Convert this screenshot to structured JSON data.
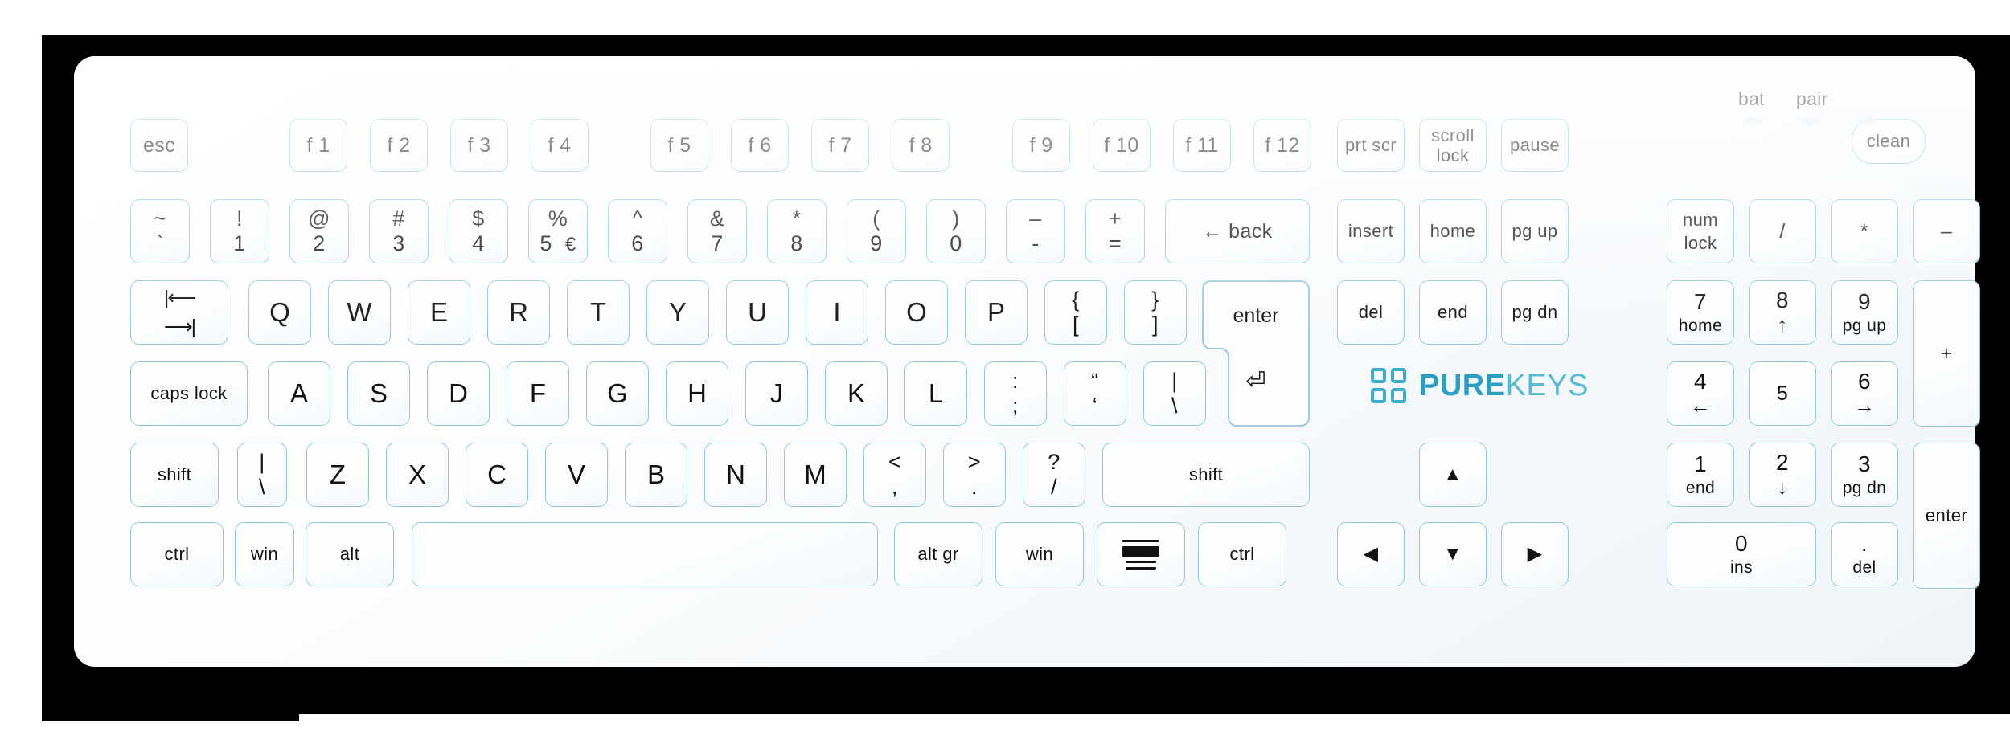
{
  "device": {
    "brand_bold": "PURE",
    "brand_light": "KEYS",
    "layout": "US / ANSI-ISO hybrid full-size hygienic keyboard"
  },
  "indicators": {
    "labels": [
      {
        "name": "bat",
        "text": "bat"
      },
      {
        "name": "pair",
        "text": "pair"
      }
    ],
    "leds": [
      "led-bat",
      "led-pair",
      "led-third"
    ]
  },
  "accent_colors": {
    "key_border": "#8fc8de",
    "logo_bold": "#2a9ec4",
    "logo_light": "#56b9d8",
    "legend": "#111111",
    "body": "#ffffff",
    "backdrop": "#000000"
  },
  "rows": {
    "function_row": [
      {
        "name": "esc",
        "label": "esc"
      },
      {
        "name": "f1",
        "label": "f 1"
      },
      {
        "name": "f2",
        "label": "f 2"
      },
      {
        "name": "f3",
        "label": "f 3"
      },
      {
        "name": "f4",
        "label": "f 4"
      },
      {
        "name": "f5",
        "label": "f 5"
      },
      {
        "name": "f6",
        "label": "f 6"
      },
      {
        "name": "f7",
        "label": "f 7"
      },
      {
        "name": "f8",
        "label": "f 8"
      },
      {
        "name": "f9",
        "label": "f 9"
      },
      {
        "name": "f10",
        "label": "f 10"
      },
      {
        "name": "f11",
        "label": "f 11"
      },
      {
        "name": "f12",
        "label": "f 12"
      },
      {
        "name": "prt-scr",
        "label": "prt scr"
      },
      {
        "name": "scroll-lock",
        "top": "scroll",
        "bot": "lock"
      },
      {
        "name": "pause",
        "label": "pause"
      },
      {
        "name": "clean",
        "label": "clean"
      }
    ],
    "number_row": [
      {
        "name": "backtick",
        "top": "~",
        "bot": "`"
      },
      {
        "name": "digit-1",
        "top": "!",
        "bot": "1"
      },
      {
        "name": "digit-2",
        "top": "@",
        "bot": "2"
      },
      {
        "name": "digit-3",
        "top": "#",
        "bot": "3"
      },
      {
        "name": "digit-4",
        "top": "$",
        "bot": "4"
      },
      {
        "name": "digit-5",
        "top": "%",
        "bot": "5",
        "extra": "€"
      },
      {
        "name": "digit-6",
        "top": "^",
        "bot": "6"
      },
      {
        "name": "digit-7",
        "top": "&",
        "bot": "7"
      },
      {
        "name": "digit-8",
        "top": "*",
        "bot": "8"
      },
      {
        "name": "digit-9",
        "top": "(",
        "bot": "9"
      },
      {
        "name": "digit-0",
        "top": ")",
        "bot": "0"
      },
      {
        "name": "minus",
        "top": "–",
        "bot": "-"
      },
      {
        "name": "equals",
        "top": "+",
        "bot": "="
      },
      {
        "name": "backspace",
        "label": "← back"
      }
    ],
    "top_row": [
      {
        "name": "tab",
        "label": "tab"
      },
      {
        "name": "letter-q",
        "label": "Q"
      },
      {
        "name": "letter-w",
        "label": "W"
      },
      {
        "name": "letter-e",
        "label": "E"
      },
      {
        "name": "letter-r",
        "label": "R"
      },
      {
        "name": "letter-t",
        "label": "T"
      },
      {
        "name": "letter-y",
        "label": "Y"
      },
      {
        "name": "letter-u",
        "label": "U"
      },
      {
        "name": "letter-i",
        "label": "I"
      },
      {
        "name": "letter-o",
        "label": "O"
      },
      {
        "name": "letter-p",
        "label": "P"
      },
      {
        "name": "bracket-left",
        "top": "{",
        "bot": "["
      },
      {
        "name": "bracket-right",
        "top": "}",
        "bot": "]"
      },
      {
        "name": "enter",
        "label": "enter"
      }
    ],
    "home_row": [
      {
        "name": "caps-lock",
        "label": "caps lock"
      },
      {
        "name": "letter-a",
        "label": "A"
      },
      {
        "name": "letter-s",
        "label": "S"
      },
      {
        "name": "letter-d",
        "label": "D"
      },
      {
        "name": "letter-f",
        "label": "F"
      },
      {
        "name": "letter-g",
        "label": "G"
      },
      {
        "name": "letter-h",
        "label": "H"
      },
      {
        "name": "letter-j",
        "label": "J"
      },
      {
        "name": "letter-k",
        "label": "K"
      },
      {
        "name": "letter-l",
        "label": "L"
      },
      {
        "name": "semicolon",
        "top": ":",
        "bot": ";"
      },
      {
        "name": "quote",
        "top": "“",
        "bot": "‘"
      },
      {
        "name": "backslash",
        "top": "|",
        "bot": "\\"
      }
    ],
    "bottom_letter_row": [
      {
        "name": "shift-left",
        "label": "shift"
      },
      {
        "name": "backslash-iso",
        "top": "|",
        "bot": "\\"
      },
      {
        "name": "letter-z",
        "label": "Z"
      },
      {
        "name": "letter-x",
        "label": "X"
      },
      {
        "name": "letter-c",
        "label": "C"
      },
      {
        "name": "letter-v",
        "label": "V"
      },
      {
        "name": "letter-b",
        "label": "B"
      },
      {
        "name": "letter-n",
        "label": "N"
      },
      {
        "name": "letter-m",
        "label": "M"
      },
      {
        "name": "comma",
        "top": "<",
        "bot": ","
      },
      {
        "name": "period",
        "top": ">",
        "bot": "."
      },
      {
        "name": "slash",
        "top": "?",
        "bot": "/"
      },
      {
        "name": "shift-right",
        "label": "shift"
      }
    ],
    "modifier_row": [
      {
        "name": "ctrl-left",
        "label": "ctrl"
      },
      {
        "name": "win-left",
        "label": "win"
      },
      {
        "name": "alt-left",
        "label": "alt"
      },
      {
        "name": "space",
        "label": ""
      },
      {
        "name": "alt-gr",
        "label": "alt gr"
      },
      {
        "name": "win-right",
        "label": "win"
      },
      {
        "name": "menu",
        "label": ""
      },
      {
        "name": "ctrl-right",
        "label": "ctrl"
      }
    ],
    "nav_cluster": [
      {
        "name": "insert",
        "label": "insert"
      },
      {
        "name": "home",
        "label": "home"
      },
      {
        "name": "pg-up",
        "label": "pg up"
      },
      {
        "name": "del",
        "label": "del"
      },
      {
        "name": "end",
        "label": "end"
      },
      {
        "name": "pg-dn",
        "label": "pg dn"
      }
    ],
    "arrow_cluster": [
      {
        "name": "arrow-up",
        "label": "▲"
      },
      {
        "name": "arrow-left",
        "label": "◀"
      },
      {
        "name": "arrow-down",
        "label": "▼"
      },
      {
        "name": "arrow-right",
        "label": "▶"
      }
    ],
    "numpad": [
      {
        "name": "num-lock",
        "top": "num",
        "bot": "lock"
      },
      {
        "name": "np-divide",
        "label": "/"
      },
      {
        "name": "np-multiply",
        "label": "*"
      },
      {
        "name": "np-minus",
        "label": "–"
      },
      {
        "name": "np-7",
        "top": "7",
        "bot": "home"
      },
      {
        "name": "np-8",
        "top": "8",
        "bot": "↑"
      },
      {
        "name": "np-9",
        "top": "9",
        "bot": "pg up"
      },
      {
        "name": "np-plus",
        "label": "+"
      },
      {
        "name": "np-4",
        "top": "4",
        "bot": "←"
      },
      {
        "name": "np-5",
        "label": "5"
      },
      {
        "name": "np-6",
        "top": "6",
        "bot": "→"
      },
      {
        "name": "np-1",
        "top": "1",
        "bot": "end"
      },
      {
        "name": "np-2",
        "top": "2",
        "bot": "↓"
      },
      {
        "name": "np-3",
        "top": "3",
        "bot": "pg dn"
      },
      {
        "name": "np-enter",
        "label": "enter"
      },
      {
        "name": "np-0",
        "top": "0",
        "bot": "ins"
      },
      {
        "name": "np-decimal",
        "top": ".",
        "bot": "del"
      }
    ]
  }
}
